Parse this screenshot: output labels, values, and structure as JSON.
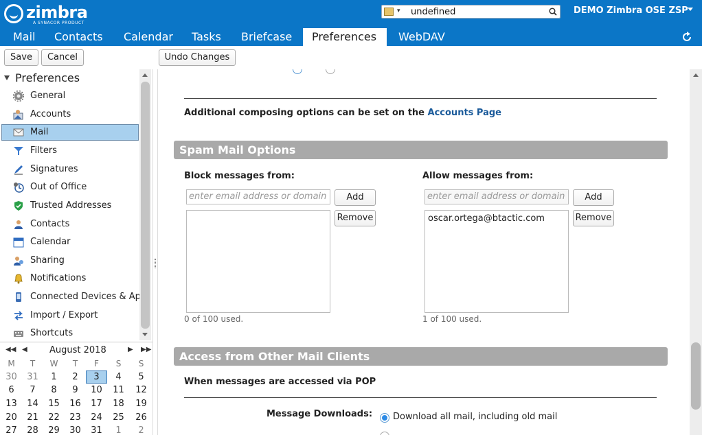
{
  "brand": {
    "name": "zimbra",
    "tagline": "A SYNACOR PRODUCT"
  },
  "search": {
    "value": "undefined"
  },
  "user": {
    "name": "DEMO Zimbra OSE ZSP"
  },
  "tabs": [
    {
      "label": "Mail"
    },
    {
      "label": "Contacts"
    },
    {
      "label": "Calendar"
    },
    {
      "label": "Tasks"
    },
    {
      "label": "Briefcase"
    },
    {
      "label": "Preferences"
    },
    {
      "label": "WebDAV"
    }
  ],
  "toolbar": {
    "save": "Save",
    "cancel": "Cancel",
    "undo": "Undo Changes"
  },
  "sidebar": {
    "header": "Preferences",
    "items": [
      {
        "label": "General",
        "icon": "gear-icon"
      },
      {
        "label": "Accounts",
        "icon": "accounts-icon"
      },
      {
        "label": "Mail",
        "icon": "envelope-icon"
      },
      {
        "label": "Filters",
        "icon": "filter-icon"
      },
      {
        "label": "Signatures",
        "icon": "pen-icon"
      },
      {
        "label": "Out of Office",
        "icon": "clock-icon"
      },
      {
        "label": "Trusted Addresses",
        "icon": "shield-icon"
      },
      {
        "label": "Contacts",
        "icon": "contact-icon"
      },
      {
        "label": "Calendar",
        "icon": "calendar-icon"
      },
      {
        "label": "Sharing",
        "icon": "sharing-icon"
      },
      {
        "label": "Notifications",
        "icon": "bell-icon"
      },
      {
        "label": "Connected Devices & Apps",
        "icon": "device-icon"
      },
      {
        "label": "Import / Export",
        "icon": "arrows-icon"
      },
      {
        "label": "Shortcuts",
        "icon": "keyboard-icon"
      }
    ]
  },
  "minical": {
    "month": "August 2018",
    "dow": [
      "M",
      "T",
      "W",
      "T",
      "F",
      "S",
      "S"
    ],
    "weeks": [
      [
        "30",
        "31",
        "1",
        "2",
        "3",
        "4",
        "5"
      ],
      [
        "6",
        "7",
        "8",
        "9",
        "10",
        "11",
        "12"
      ],
      [
        "13",
        "14",
        "15",
        "16",
        "17",
        "18",
        "19"
      ],
      [
        "20",
        "21",
        "22",
        "23",
        "24",
        "25",
        "26"
      ],
      [
        "27",
        "28",
        "29",
        "30",
        "31",
        "1",
        "2"
      ]
    ]
  },
  "main": {
    "composing_note": "Additional composing options can be set on the",
    "accounts_link": "Accounts Page",
    "spam": {
      "title": "Spam Mail Options",
      "block_label": "Block messages from:",
      "allow_label": "Allow messages from:",
      "placeholder": "enter email address or domain",
      "add": "Add",
      "remove": "Remove",
      "block_used": "0 of 100 used.",
      "allow_used": "1 of 100 used.",
      "allow_entries": [
        "oscar.ortega@btactic.com"
      ]
    },
    "access": {
      "title": "Access from Other Mail Clients",
      "pop_heading": "When messages are accessed via POP",
      "downloads_label": "Message Downloads:",
      "download_option": "Download all mail, including old mail"
    }
  }
}
